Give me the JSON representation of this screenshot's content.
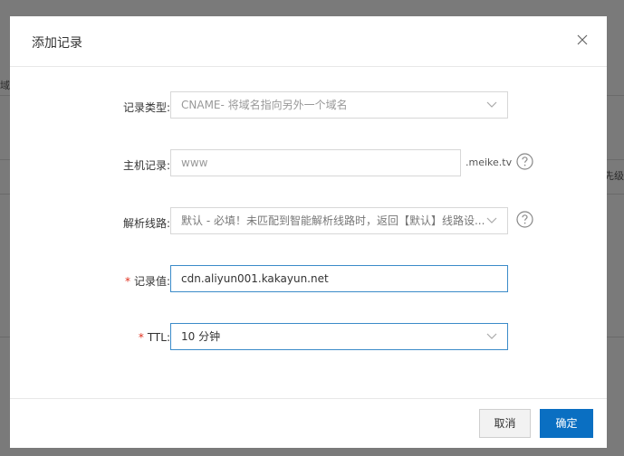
{
  "background": {
    "left_fragment": "域名",
    "right_fragment": "先级"
  },
  "dialog": {
    "title": "添加记录",
    "close_icon": "close-icon",
    "fields": {
      "record_type": {
        "label": "记录类型:",
        "value": "CNAME- 将域名指向另外一个域名"
      },
      "host": {
        "label": "主机记录:",
        "placeholder": "www",
        "suffix": ".meike.tv"
      },
      "line": {
        "label": "解析线路:",
        "value": "默认 - 必填！未匹配到智能解析线路时，返回【默认】线路设..."
      },
      "record_value": {
        "required_mark": "*",
        "label": "记录值:",
        "value": "cdn.aliyun001.kakayun.net"
      },
      "ttl": {
        "required_mark": "*",
        "label": "TTL:",
        "value": "10 分钟"
      }
    },
    "footer": {
      "cancel_label": "取消",
      "ok_label": "确定"
    }
  },
  "colors": {
    "primary": "#0a6fc2",
    "focus_border": "#3b8bc9",
    "required": "#e0301e",
    "overlay": "#7a7a7a"
  }
}
